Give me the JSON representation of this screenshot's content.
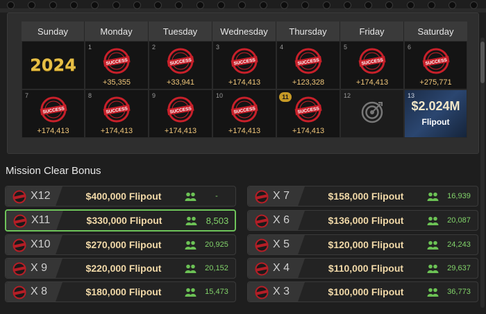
{
  "calendar": {
    "days": [
      "Sunday",
      "Monday",
      "Tuesday",
      "Wednesday",
      "Thursday",
      "Friday",
      "Saturday"
    ],
    "year_label": "2024",
    "stamp_text": "SUCCESS",
    "week1": [
      {
        "day": "1",
        "amount": "+35,355"
      },
      {
        "day": "2",
        "amount": "+33,941"
      },
      {
        "day": "3",
        "amount": "+174,413"
      },
      {
        "day": "4",
        "amount": "+123,328"
      },
      {
        "day": "5",
        "amount": "+174,413"
      },
      {
        "day": "6",
        "amount": "+275,771"
      }
    ],
    "week2": [
      {
        "day": "7",
        "amount": "+174,413"
      },
      {
        "day": "8",
        "amount": "+174,413"
      },
      {
        "day": "9",
        "amount": "+174,413"
      },
      {
        "day": "10",
        "amount": "+174,413"
      },
      {
        "day": "11",
        "amount": "+174,413"
      }
    ],
    "day12": "12",
    "day13": "13",
    "prize_amount": "$2.024M",
    "prize_label": "Flipout"
  },
  "bonus": {
    "title": "Mission Clear Bonus",
    "left": [
      {
        "mult": "X12",
        "prize": "$400,000 Flipout",
        "count": "-"
      },
      {
        "mult": "X11",
        "prize": "$330,000 Flipout",
        "count": "8,503"
      },
      {
        "mult": "X10",
        "prize": "$270,000 Flipout",
        "count": "20,925"
      },
      {
        "mult": "X 9",
        "prize": "$220,000 Flipout",
        "count": "20,152"
      },
      {
        "mult": "X 8",
        "prize": "$180,000 Flipout",
        "count": "15,473"
      }
    ],
    "right": [
      {
        "mult": "X 7",
        "prize": "$158,000 Flipout",
        "count": "16,939"
      },
      {
        "mult": "X 6",
        "prize": "$136,000 Flipout",
        "count": "20,087"
      },
      {
        "mult": "X 5",
        "prize": "$120,000 Flipout",
        "count": "24,243"
      },
      {
        "mult": "X 4",
        "prize": "$110,000 Flipout",
        "count": "29,637"
      },
      {
        "mult": "X 3",
        "prize": "$100,000 Flipout",
        "count": "36,773"
      }
    ]
  },
  "colors": {
    "accent_gold": "#f1c77a",
    "success_red": "#c8202a",
    "count_green": "#82d36a",
    "active_border": "#6ec45a"
  },
  "icons": {
    "stamp": "success-stamp-icon",
    "target": "target-icon",
    "people": "people-icon"
  }
}
